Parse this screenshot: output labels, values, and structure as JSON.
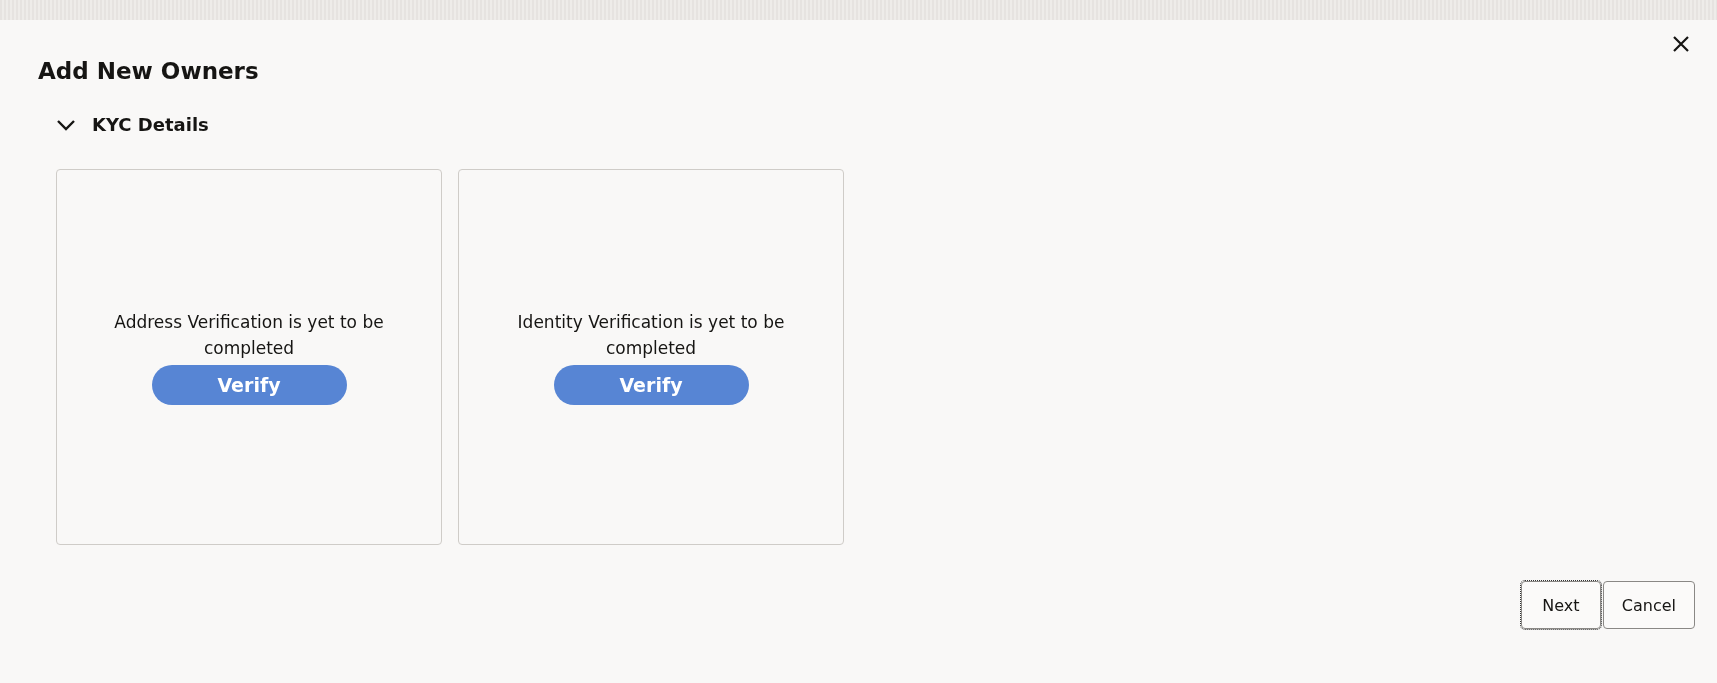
{
  "dialog": {
    "title": "Add New Owners"
  },
  "section": {
    "title": "KYC Details",
    "expanded": true
  },
  "cards": [
    {
      "message": "Address Verification is yet to be completed",
      "button": "Verify"
    },
    {
      "message": "Identity Verification is yet to be completed",
      "button": "Verify"
    }
  ],
  "footer_buttons": [
    {
      "label": "Next",
      "focused": true
    },
    {
      "label": "Cancel",
      "focused": false
    }
  ]
}
